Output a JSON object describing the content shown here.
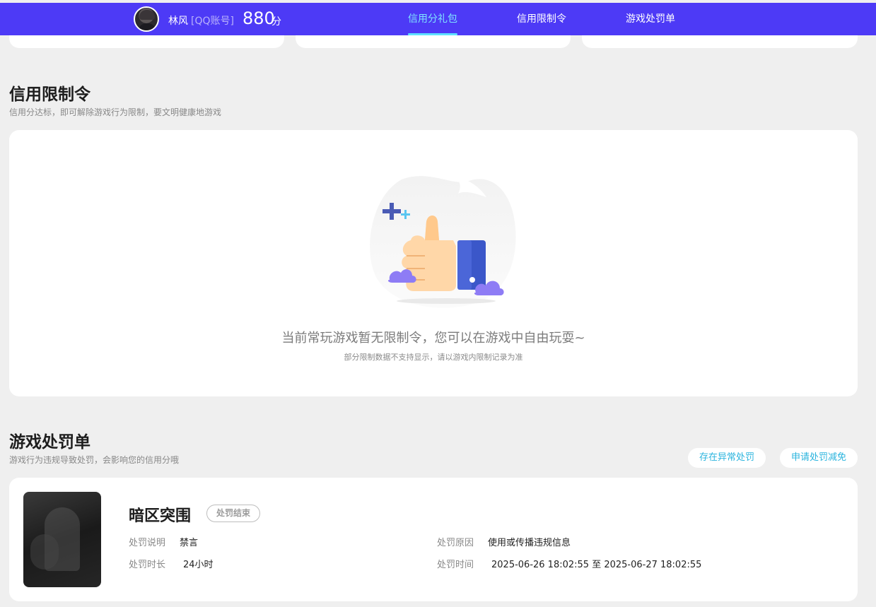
{
  "header": {
    "username": "林风",
    "account_type": "[QQ账号]",
    "score": "880",
    "score_unit": "分",
    "tabs": [
      {
        "label": "信用分礼包",
        "active": true
      },
      {
        "label": "信用限制令",
        "active": false
      },
      {
        "label": "游戏处罚单",
        "active": false
      }
    ],
    "brand_color": "#4d3af6",
    "active_tab_color": "#7ee4ff"
  },
  "restriction_section": {
    "title": "信用限制令",
    "subtitle": "信用分达标，即可解除游戏行为限制，要文明健康地游戏",
    "empty_message": "当前常玩游戏暂无限制令，您可以在游戏中自由玩耍~",
    "empty_note": "部分限制数据不支持显示，请以游戏内限制记录为准",
    "illustration": "thumbs-up-illustration"
  },
  "penalty_section": {
    "title": "游戏处罚单",
    "subtitle": "游戏行为违规导致处罚，会影响您的信用分哦",
    "actions": {
      "abnormal_label": "存在异常处罚",
      "reduce_label": "申请处罚减免"
    },
    "record": {
      "game_name": "暗区突围",
      "status": "处罚结束",
      "description_label": "处罚说明",
      "description_value": "禁言",
      "reason_label": "处罚原因",
      "reason_value": "使用或传播违规信息",
      "duration_label": "处罚时长",
      "duration_value": "24小时",
      "time_label": "处罚时间",
      "time_value": "2025-06-26 18:02:55 至 2025-06-27 18:02:55"
    }
  }
}
